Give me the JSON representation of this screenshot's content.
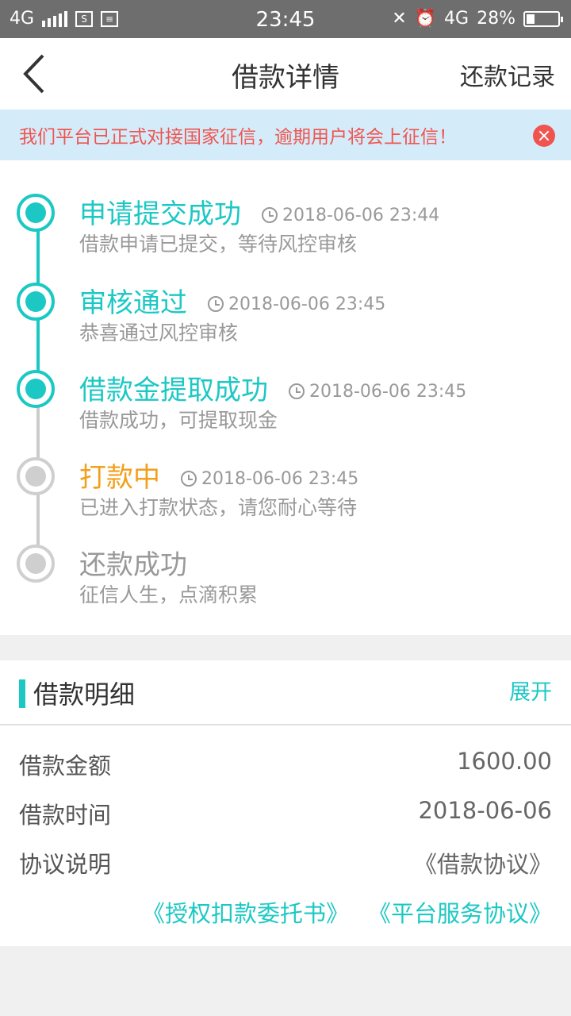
{
  "status_bar": {
    "network_left": "4G",
    "time": "23:45",
    "network_right": "4G",
    "battery": "28%"
  },
  "nav": {
    "title": "借款详情",
    "right_action": "还款记录"
  },
  "notice": {
    "text": "我们平台已正式对接国家征信，逾期用户将会上征信！"
  },
  "timeline": [
    {
      "title": "申请提交成功",
      "time": "2018-06-06 23:44",
      "desc": "借款申请已提交，等待风控审核",
      "state": "done"
    },
    {
      "title": "审核通过",
      "time": "2018-06-06 23:45",
      "desc": "恭喜通过风控审核",
      "state": "done"
    },
    {
      "title": "借款金提取成功",
      "time": "2018-06-06 23:45",
      "desc": "借款成功，可提取现金",
      "state": "done"
    },
    {
      "title": "打款中",
      "time": "2018-06-06 23:45",
      "desc": "已进入打款状态，请您耐心等待",
      "state": "current"
    },
    {
      "title": "还款成功",
      "time": "",
      "desc": "征信人生，点滴积累",
      "state": "pending"
    }
  ],
  "details": {
    "title": "借款明细",
    "expand": "展开",
    "amount_label": "借款金额",
    "amount_value": "1600.00",
    "time_label": "借款时间",
    "time_value": "2018-06-06",
    "agreement_label": "协议说明",
    "link_loan": "《借款协议》",
    "link_authorization": "《授权扣款委托书》",
    "link_service": "《平台服务协议》"
  },
  "colors": {
    "accent": "#1cc8c4",
    "current": "#f2a01c",
    "notice_text": "#f0544f",
    "notice_bg": "#d4ecfa"
  }
}
